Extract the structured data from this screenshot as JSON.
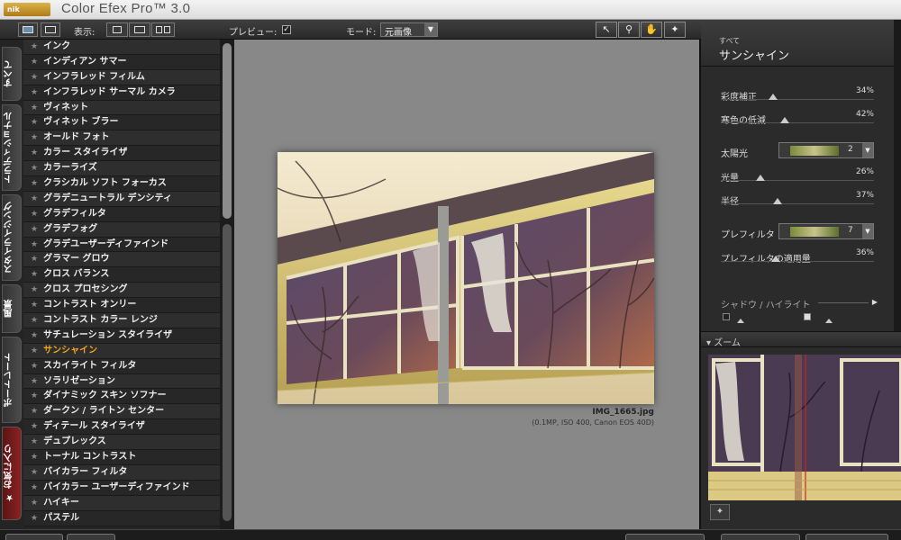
{
  "app": {
    "logo_text": "nik",
    "title": "Color Efex Pro™ 3.0"
  },
  "toolbar": {
    "display_label": "表示:",
    "preview_label": "プレビュー:",
    "preview_checked": "✓",
    "mode_label": "モード:",
    "mode_value": "元画像",
    "tools": [
      "pointer-icon",
      "zoom-icon",
      "hand-icon",
      "light-icon"
    ]
  },
  "tabs": [
    {
      "label": "すべて",
      "active": false
    },
    {
      "label": "トラディショナル",
      "active": false
    },
    {
      "label": "スタイライジング",
      "active": false
    },
    {
      "label": "風景",
      "active": false
    },
    {
      "label": "ポートレート",
      "active": false
    },
    {
      "label": "お気に入り",
      "active": false,
      "icon": "★"
    }
  ],
  "filters": [
    "インク",
    "インディアン サマー",
    "インフラレッド フィルム",
    "インフラレッド サーマル カメラ",
    "ヴィネット",
    "ヴィネット ブラー",
    "オールド フォト",
    "カラー スタイライザ",
    "カラーライズ",
    "クラシカル ソフト フォーカス",
    "グラデニュートラル デンシティ",
    "グラデフィルタ",
    "グラデフォグ",
    "グラデユーザーディファインド",
    "グラマー グロウ",
    "クロス バランス",
    "クロス プロセシング",
    "コントラスト オンリー",
    "コントラスト カラー レンジ",
    "サチュレーション スタイライザ",
    "サンシャイン",
    "スカイライト フィルタ",
    "ソラリゼーション",
    "ダイナミック スキン ソフナー",
    "ダークン / ライトン センター",
    "ディテール スタイライザ",
    "デュプレックス",
    "トーナル コントラスト",
    "バイカラー フィルタ",
    "バイカラー ユーザーディファインド",
    "ハイキー",
    "パステル"
  ],
  "active_filter": "サンシャイン",
  "preview": {
    "filename": "IMG_1665.jpg",
    "info": "(0.1MP, ISO 400, Canon EOS 40D)"
  },
  "panel": {
    "breadcrumb": "すべて",
    "filter_name": "サンシャイン",
    "sliders": [
      {
        "label": "彩度補正",
        "value": "34%",
        "level": 0.34
      },
      {
        "label": "寒色の低減",
        "value": "42%",
        "level": 0.42
      }
    ],
    "sun": {
      "label": "太陽光",
      "value": "2"
    },
    "sliders2": [
      {
        "label": "光量",
        "value": "26%",
        "level": 0.26
      },
      {
        "label": "半径",
        "value": "37%",
        "level": 0.37
      }
    ],
    "prefilter": {
      "label": "プレフィルタ",
      "value": "7"
    },
    "prefilter_amount": {
      "label": "プレフィルタの適用量",
      "value": "36%",
      "level": 0.36
    },
    "shadow_highlight": "シャドウ / ハイライト",
    "zoom_label": "ズーム",
    "colors": {
      "accent": "#f2a521",
      "panel": "#2b2b2b",
      "preview_bg": "#888888"
    }
  }
}
